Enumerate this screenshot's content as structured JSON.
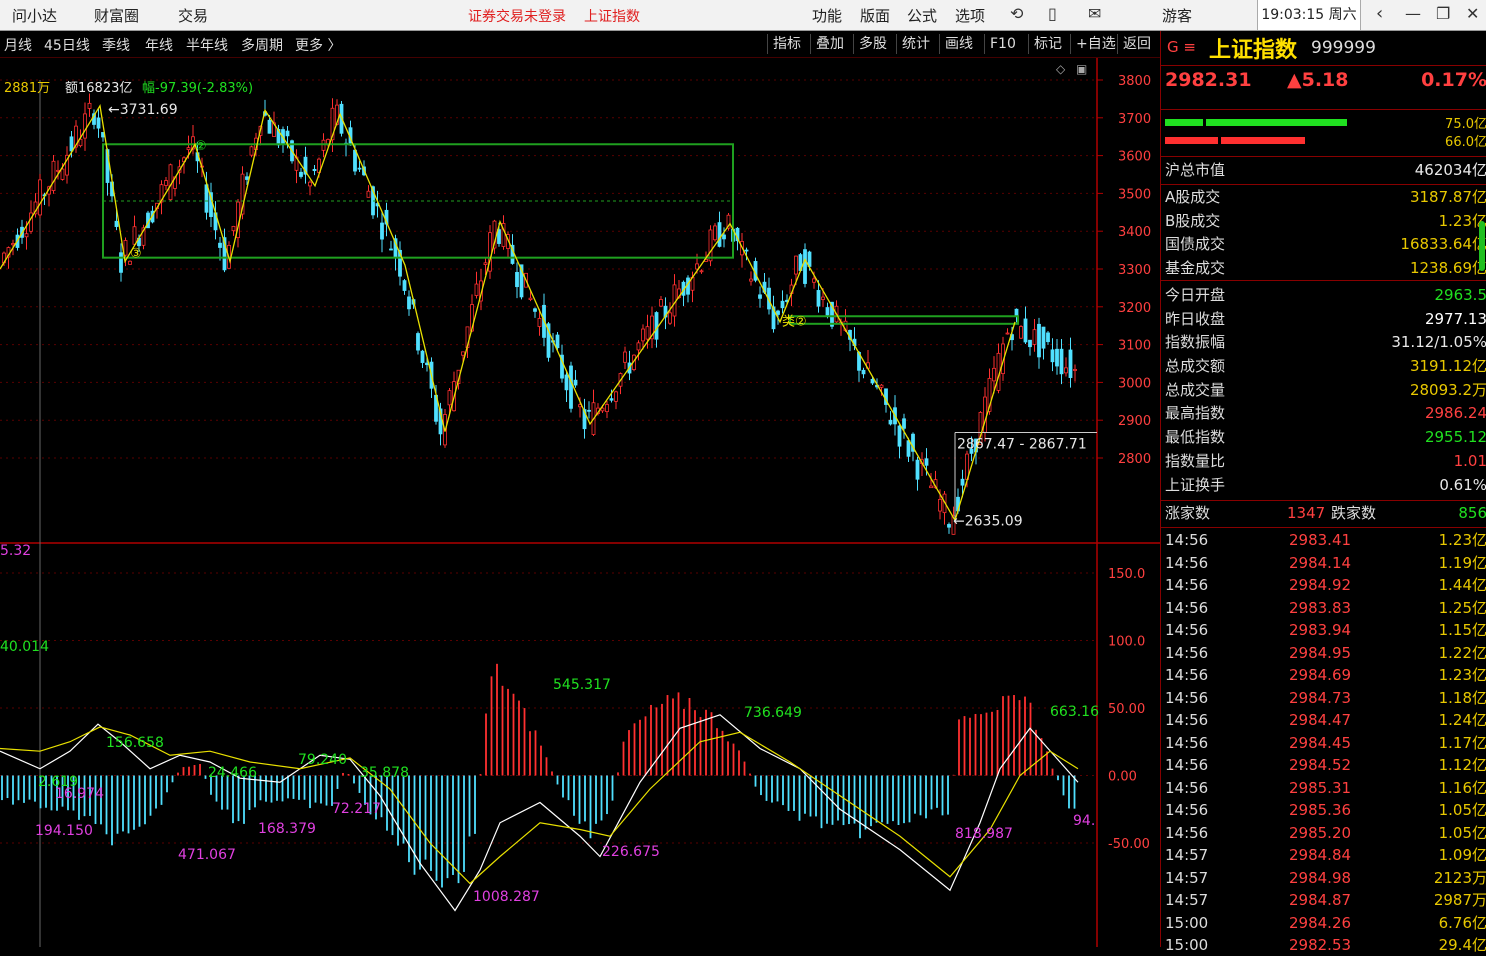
{
  "topbar": {
    "menu": [
      "问小达",
      "财富圈",
      "交易"
    ],
    "status": "证券交易未登录",
    "index_name": "上证指数",
    "right_menu": [
      "功能",
      "版面",
      "公式",
      "选项"
    ],
    "user": "游客",
    "clock": "19:03:15 周六"
  },
  "toolbar": {
    "periods": [
      "月线",
      "45日线",
      "季线",
      "年线",
      "半年线",
      "多周期",
      "更多 〉"
    ],
    "buttons": [
      "指标",
      "叠加",
      "多股",
      "统计",
      "画线",
      "F10",
      "标记",
      "+自选",
      "返回"
    ]
  },
  "info_line": {
    "vol": "2881万",
    "amount": "额16823亿",
    "change": "幅-97.39(-2.83%)"
  },
  "chart_data": [
    {
      "type": "candlestick",
      "y_ticks": [
        "3800",
        "3700",
        "3600",
        "3500",
        "3400",
        "3300",
        "3200",
        "3100",
        "3000",
        "2900",
        "2800"
      ],
      "ylim": [
        2800,
        3800
      ],
      "annotations": [
        "3731.69",
        "2867.47 - 2867.71",
        "2635.09"
      ],
      "zigzag": [
        [
          0,
          3300
        ],
        [
          100,
          3731.69
        ],
        [
          125,
          3320
        ],
        [
          195,
          3630
        ],
        [
          230,
          3320
        ],
        [
          265,
          3720
        ],
        [
          315,
          3520
        ],
        [
          340,
          3710
        ],
        [
          405,
          3310
        ],
        [
          445,
          2870
        ],
        [
          500,
          3425
        ],
        [
          590,
          2890
        ],
        [
          730,
          3420
        ],
        [
          780,
          3160
        ],
        [
          805,
          3325
        ],
        [
          865,
          3050
        ],
        [
          955,
          2635.09
        ],
        [
          1015,
          3160
        ]
      ],
      "boxes": [
        {
          "x1": 103,
          "x2": 733,
          "y1": 3330,
          "y2": 3630,
          "mid": 3480
        },
        {
          "x1": 790,
          "x2": 1018,
          "y1": 3155,
          "y2": 3175
        }
      ],
      "box_labels": [
        "②",
        "③",
        "类②"
      ]
    },
    {
      "type": "macd",
      "y_ticks": [
        "150.0",
        "100.0",
        "50.00",
        "0.00",
        "-50.00"
      ],
      "ylim": [
        -75,
        165
      ],
      "value_labels": [
        "5.32",
        "40.014",
        "2.619",
        "16.974",
        "194.150",
        "156.658",
        "471.067",
        "24.466",
        "168.379",
        "79.240",
        "72.217",
        "35.878",
        "1008.287",
        "545.317",
        "226.675",
        "736.649",
        "818.987",
        "663.16",
        "94."
      ]
    }
  ],
  "quote": {
    "mark": "G ≡",
    "name": "上证指数",
    "code": "999999",
    "price": "2982.31",
    "change": "▲5.18",
    "pct": "0.17%",
    "bar1_value": "75.0亿",
    "bar2_value": "66.0亿",
    "bar1_pct": 0.65,
    "bar2_pct": 0.5
  },
  "stats": [
    {
      "label": "沪总市值",
      "value": "462034亿",
      "color": "#e8e8e8"
    },
    {
      "label": "A股成交",
      "value": "3187.87亿",
      "color": "#e8c800"
    },
    {
      "label": "B股成交",
      "value": "1.23亿",
      "color": "#e8c800"
    },
    {
      "label": "国债成交",
      "value": "16833.64亿",
      "color": "#e8c800"
    },
    {
      "label": "基金成交",
      "value": "1238.69亿",
      "color": "#e8c800"
    },
    {
      "label": "今日开盘",
      "value": "2963.5",
      "color": "#20e020"
    },
    {
      "label": "昨日收盘",
      "value": "2977.13",
      "color": "#ffffff"
    },
    {
      "label": "指数振幅",
      "value": "31.12/1.05%",
      "color": "#e8e8e8"
    },
    {
      "label": "总成交额",
      "value": "3191.12亿",
      "color": "#e8c800"
    },
    {
      "label": "总成交量",
      "value": "28093.2万",
      "color": "#e8c800"
    },
    {
      "label": "最高指数",
      "value": "2986.24",
      "color": "#ff4040"
    },
    {
      "label": "最低指数",
      "value": "2955.12",
      "color": "#20e020"
    },
    {
      "label": "指数量比",
      "value": "1.01",
      "color": "#ff4040"
    },
    {
      "label": "上证换手",
      "value": "0.61%",
      "color": "#e8e8e8"
    }
  ],
  "updown": {
    "up_label": "涨家数",
    "up": "1347",
    "down_label": "跌家数",
    "down": "856"
  },
  "ticks": [
    {
      "t": "14:56",
      "p": "2983.41",
      "v": "1.23亿"
    },
    {
      "t": "14:56",
      "p": "2984.14",
      "v": "1.19亿"
    },
    {
      "t": "14:56",
      "p": "2984.92",
      "v": "1.44亿"
    },
    {
      "t": "14:56",
      "p": "2983.83",
      "v": "1.25亿"
    },
    {
      "t": "14:56",
      "p": "2983.94",
      "v": "1.15亿"
    },
    {
      "t": "14:56",
      "p": "2984.95",
      "v": "1.22亿"
    },
    {
      "t": "14:56",
      "p": "2984.69",
      "v": "1.23亿"
    },
    {
      "t": "14:56",
      "p": "2984.73",
      "v": "1.18亿"
    },
    {
      "t": "14:56",
      "p": "2984.47",
      "v": "1.24亿"
    },
    {
      "t": "14:56",
      "p": "2984.45",
      "v": "1.17亿"
    },
    {
      "t": "14:56",
      "p": "2984.52",
      "v": "1.12亿"
    },
    {
      "t": "14:56",
      "p": "2985.31",
      "v": "1.16亿"
    },
    {
      "t": "14:56",
      "p": "2985.36",
      "v": "1.05亿"
    },
    {
      "t": "14:56",
      "p": "2985.20",
      "v": "1.05亿"
    },
    {
      "t": "14:57",
      "p": "2984.84",
      "v": "1.09亿"
    },
    {
      "t": "14:57",
      "p": "2984.98",
      "v": "2123万"
    },
    {
      "t": "14:57",
      "p": "2984.87",
      "v": "2987万"
    },
    {
      "t": "15:00",
      "p": "2984.26",
      "v": "6.76亿"
    },
    {
      "t": "15:00",
      "p": "2982.53",
      "v": "29.4亿"
    }
  ]
}
